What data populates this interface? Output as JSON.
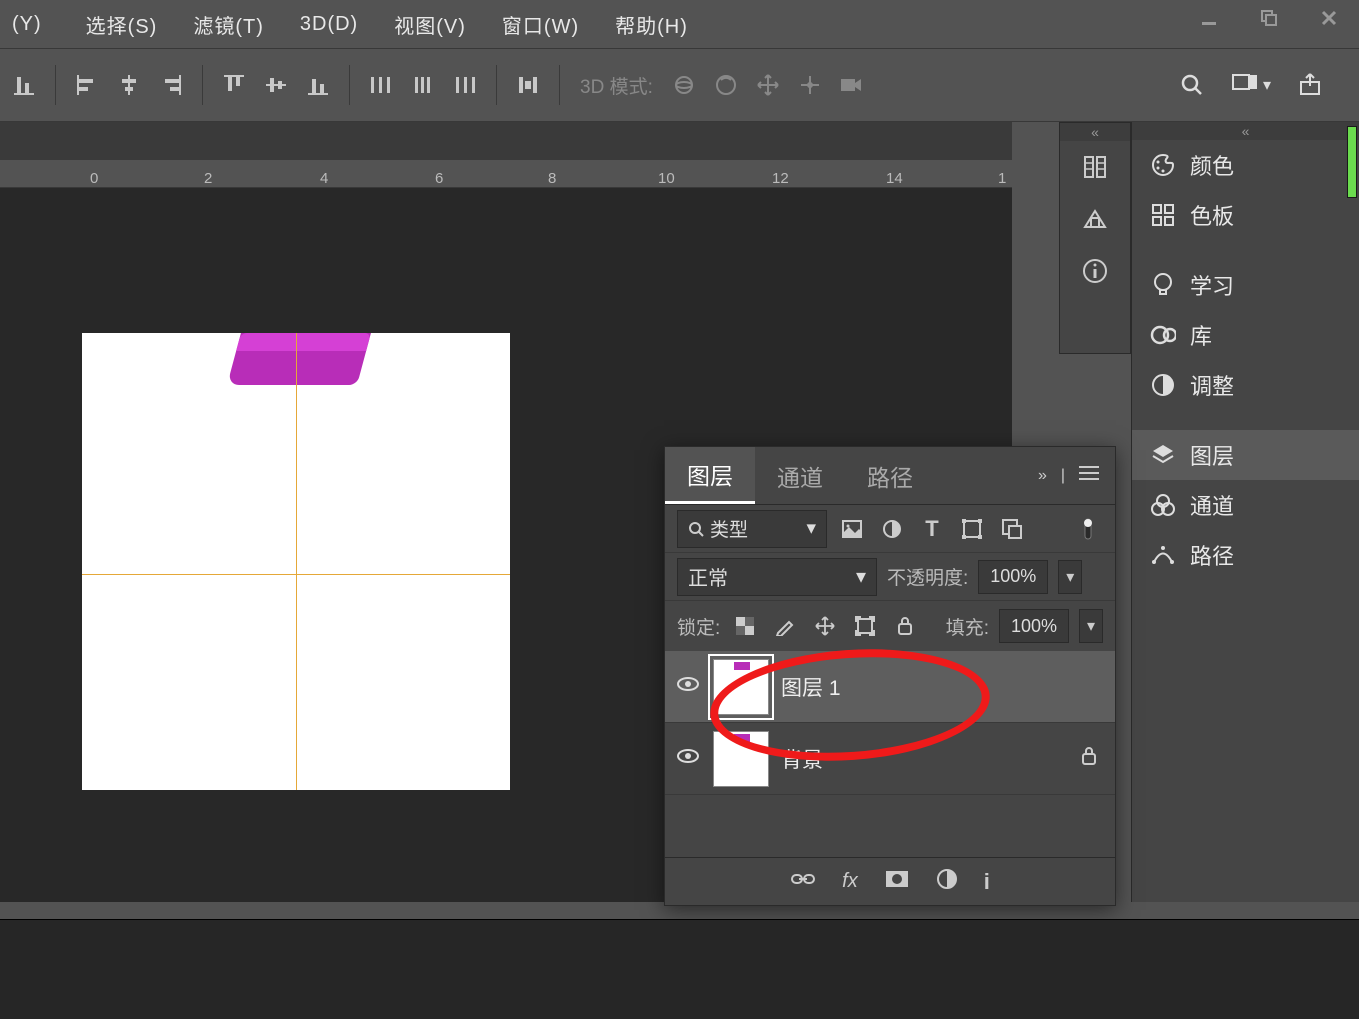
{
  "menu": {
    "items": [
      "(Y)",
      "选择(S)",
      "滤镜(T)",
      "3D(D)",
      "视图(V)",
      "窗口(W)",
      "帮助(H)"
    ]
  },
  "options": {
    "mode3d": "3D 模式:"
  },
  "ruler": {
    "ticks": [
      0,
      2,
      4,
      6,
      8,
      10,
      12,
      14,
      1
    ]
  },
  "rightStrip": {
    "collapse": "«"
  },
  "rightPanels": {
    "collapse": "«",
    "items": [
      {
        "icon": "palette",
        "label": "颜色"
      },
      {
        "icon": "swatches",
        "label": "色板"
      },
      {
        "icon": "learn",
        "label": "学习"
      },
      {
        "icon": "cc",
        "label": "库"
      },
      {
        "icon": "adjust",
        "label": "调整"
      },
      {
        "icon": "layers",
        "label": "图层"
      },
      {
        "icon": "channels",
        "label": "通道"
      },
      {
        "icon": "paths",
        "label": "路径"
      }
    ]
  },
  "layersPanel": {
    "tabs": [
      "图层",
      "通道",
      "路径"
    ],
    "expand": "»",
    "filterLabel": "类型",
    "blendMode": "正常",
    "opacityLabel": "不透明度:",
    "opacityValue": "100%",
    "lockLabel": "锁定:",
    "fillLabel": "填充:",
    "fillValue": "100%",
    "layers": [
      {
        "name": "图层 1",
        "selected": true,
        "locked": false
      },
      {
        "name": "背景",
        "selected": false,
        "locked": true
      }
    ],
    "bottomFx": "fx"
  }
}
